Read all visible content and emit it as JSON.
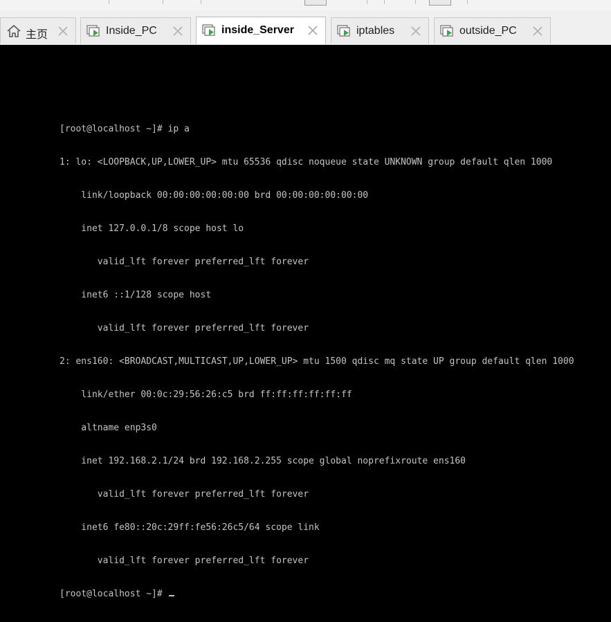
{
  "tabs": [
    {
      "label": "主页",
      "icon": "home-icon",
      "active": false
    },
    {
      "label": "Inside_PC",
      "icon": "vm-icon",
      "active": false
    },
    {
      "label": "inside_Server",
      "icon": "vm-icon",
      "active": true
    },
    {
      "label": "iptables",
      "icon": "vm-icon",
      "active": false
    },
    {
      "label": "outside_PC",
      "icon": "vm-icon",
      "active": false
    }
  ],
  "terminal": {
    "lines": [
      "[root@localhost ~]# ip a",
      "1: lo: <LOOPBACK,UP,LOWER_UP> mtu 65536 qdisc noqueue state UNKNOWN group default qlen 1000",
      "    link/loopback 00:00:00:00:00:00 brd 00:00:00:00:00:00",
      "    inet 127.0.0.1/8 scope host lo",
      "       valid_lft forever preferred_lft forever",
      "    inet6 ::1/128 scope host",
      "       valid_lft forever preferred_lft forever",
      "2: ens160: <BROADCAST,MULTICAST,UP,LOWER_UP> mtu 1500 qdisc mq state UP group default qlen 1000",
      "    link/ether 00:0c:29:56:26:c5 brd ff:ff:ff:ff:ff:ff",
      "    altname enp3s0",
      "    inet 192.168.2.1/24 brd 192.168.2.255 scope global noprefixroute ens160",
      "       valid_lft forever preferred_lft forever",
      "    inet6 fe80::20c:29ff:fe56:26c5/64 scope link",
      "       valid_lft forever preferred_lft forever"
    ],
    "prompt": "[root@localhost ~]# "
  },
  "colors": {
    "terminal_bg": "#000000",
    "terminal_fg": "#c4c4c4",
    "vm_icon_green": "#3aa64a"
  }
}
